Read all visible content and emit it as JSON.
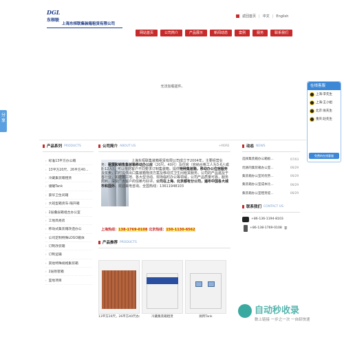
{
  "header": {
    "logo_mark": "DGL",
    "logo_cn": "东桓联",
    "company_name": "上海东桓联集装箱租赁有限公司",
    "toplinks": [
      "返回首页",
      "中文",
      "English"
    ]
  },
  "nav": [
    "网站首页",
    "公司简介",
    "产品展示",
    "新闻动态",
    "案例",
    "服务",
    "联系我们"
  ],
  "banner": {
    "text": "无法加载插件。"
  },
  "share_tab": "分享",
  "qq": {
    "title": "在线客服",
    "items": [
      "上海:李先生",
      "上海:王小姐",
      "北京:张先生",
      "重庆:赵先生"
    ],
    "footer": "免费的在线客服"
  },
  "products": {
    "title": "产品系列",
    "title_en": "PRODUCTS",
    "items": [
      "标准13平方办公箱",
      "13平方20尺、26平方40...",
      "冷藏集装箱租赁",
      "储罐Tank",
      "豪华卫生间箱",
      "大班型箱货车-隔开箱",
      "2层叠层箱组合办公室",
      "工地简易房",
      "移动式集装箱改造办公",
      "公司定制特殊LOGO箱体",
      "订制改装箱",
      "订制运输",
      "其他特殊规格集装箱",
      "2层别墅箱",
      "室地项目"
    ]
  },
  "about": {
    "title": "公司简介",
    "title_en": "ABOUT US",
    "more": "+MORE",
    "text_1": "上海东桓联集装箱租赁有限公司成立于2004年，主要经营业务：",
    "text_b1": "租赁和销售集装箱移动办公房",
    "text_2": "（20尺，40尺）及住房（容纳合格工人为3-6人或8-12人），可以根据客户不同要求订制集装箱。提供",
    "text_b2": "特种集装箱，移动办公住宿服务",
    "text_3": "及买卖，同时提供出口集装箱物流方案及移动式卫生间租赁服务。公司的产品遍及于各行业，如建筑工地、各大型活动、现场临时办公等领域，公司产品质量可靠，服务周到，深受广大客户的信赖与好评。",
    "text_b3": "公司在上海、北京都有分公司，遍布中国各大城市和国外",
    "text_4": "，欢迎来电咨询。全国热线：13611948103",
    "hotline_label": "上海热线：",
    "hotline_1": "138-1769-0108",
    "hotline_beijing_label": "北京热线：",
    "hotline_2": "150-1130-6562"
  },
  "featured": {
    "title": "产品推荐",
    "title_en": "PRODUCTS",
    "items": [
      "13平方20尺，26平方40尺办公箱",
      "冷藏集装箱租赁",
      "厕所Tank",
      ""
    ]
  },
  "news": {
    "title": "动态",
    "title_en": "NEWS",
    "items": [
      {
        "t": "选择集装箱办公箱板...",
        "d": "07/03"
      },
      {
        "t": "优质的集装箱办公室...",
        "d": "06/29"
      },
      {
        "t": "集装箱办公室的优势...",
        "d": "06/29"
      },
      {
        "t": "集装箱办公室成本比...",
        "d": "06/29"
      },
      {
        "t": "集装箱办公室租赁提...",
        "d": "06/29"
      }
    ]
  },
  "contact": {
    "title": "联系我们",
    "title_en": "CONTACT US",
    "phone": "+86-136-1194-8103",
    "mobile": "+86-138-1769-0108",
    "name_suffix": "李"
  },
  "watermark": {
    "title": "自动秒收录",
    "sub": "数上链接 一步之一次 一自卸快速"
  }
}
